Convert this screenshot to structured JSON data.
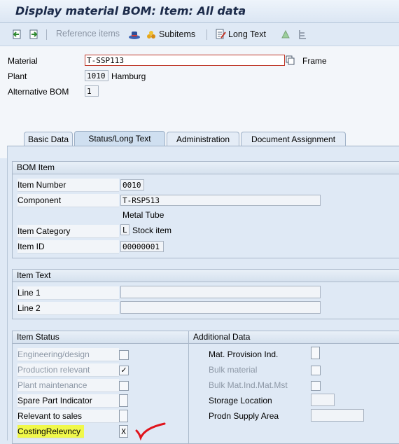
{
  "window": {
    "title": "Display material BOM: Item: All data"
  },
  "toolbar": {
    "reference_items": "Reference items",
    "subitems": "Subitems",
    "long_text": "Long Text"
  },
  "header": {
    "material_label": "Material",
    "material_value": "T-SSP113",
    "material_desc": "Frame",
    "plant_label": "Plant",
    "plant_value": "1010",
    "plant_desc": "Hamburg",
    "altbom_label": "Alternative BOM",
    "altbom_value": "1"
  },
  "tabs": [
    "Basic Data",
    "Status/Long Text",
    "Administration",
    "Document Assignment"
  ],
  "bom_item": {
    "title": "BOM Item",
    "item_number_label": "Item Number",
    "item_number_value": "0010",
    "component_label": "Component",
    "component_value": "T-RSP513",
    "component_desc": "Metal Tube",
    "item_category_label": "Item Category",
    "item_category_value": "L",
    "item_category_desc": "Stock item",
    "item_id_label": "Item ID",
    "item_id_value": "00000001"
  },
  "item_text": {
    "title": "Item Text",
    "line1_label": "Line 1",
    "line1_value": "",
    "line2_label": "Line 2",
    "line2_value": ""
  },
  "item_status": {
    "title": "Item Status",
    "engineering": "Engineering/design",
    "production": "Production relevant",
    "plant_maint": "Plant maintenance",
    "spare_part": "Spare Part Indicator",
    "relevant_sales": "Relevant to sales",
    "costing": "CostingRelevncy",
    "costing_value": "X",
    "production_checked": true
  },
  "additional_data": {
    "title": "Additional Data",
    "mat_provision": "Mat. Provision Ind.",
    "bulk_material": "Bulk material",
    "bulk_mat_ind": "Bulk Mat.Ind.Mat.Mst",
    "storage_location": "Storage Location",
    "prodn_supply": "Prodn Supply Area"
  },
  "colors": {
    "highlight": "#f0f84a",
    "annotation": "#e0141c",
    "accent": "#1c2b4a"
  }
}
